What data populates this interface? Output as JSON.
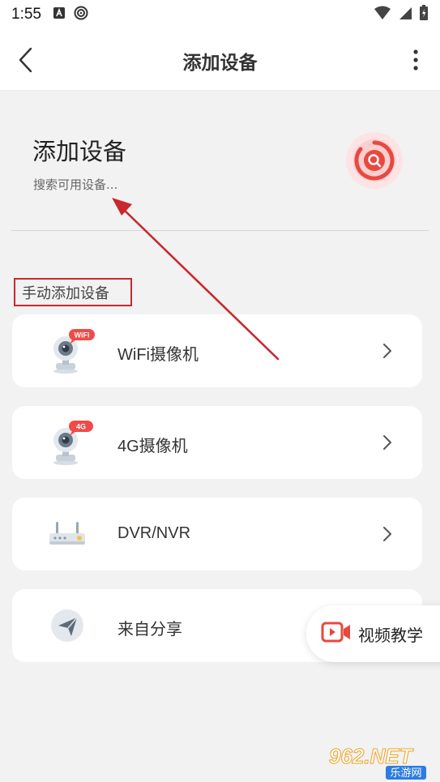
{
  "status_bar": {
    "time": "1:55"
  },
  "app_bar": {
    "title": "添加设备"
  },
  "search": {
    "title": "添加设备",
    "subtitle": "搜索可用设备..."
  },
  "manual": {
    "section_label": "手动添加设备"
  },
  "devices": [
    {
      "label": "WiFi摄像机",
      "badge": "WiFi",
      "icon": "wifi-camera-icon"
    },
    {
      "label": "4G摄像机",
      "badge": "4G",
      "icon": "4g-camera-icon"
    },
    {
      "label": "DVR/NVR",
      "icon": "router-icon"
    },
    {
      "label": "来自分享",
      "icon": "paper-plane-icon"
    }
  ],
  "floating": {
    "video_tutorial_label": "视频教学"
  },
  "watermark": {
    "brand": "962.NET",
    "sub": "乐游网"
  },
  "colors": {
    "accent_red": "#e8493f",
    "annotation_red": "#c8282e",
    "badge_red": "#f04a4a"
  }
}
